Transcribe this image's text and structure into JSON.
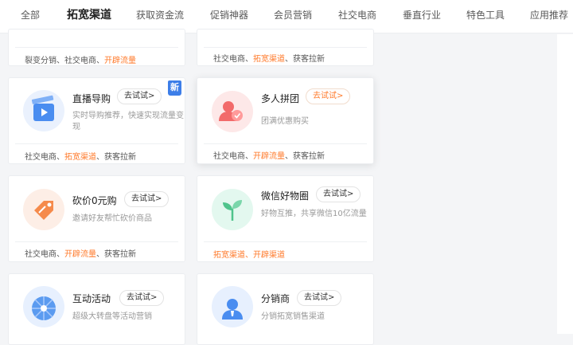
{
  "tabs": [
    "全部",
    "拓宽渠道",
    "获取资金流",
    "促销神器",
    "会员营销",
    "社交电商",
    "垂直行业",
    "特色工具",
    "应用推荐"
  ],
  "active_tab": "拓宽渠道",
  "accent_color": "#ff7a2b",
  "cards": [
    {
      "title": "",
      "try_label": "",
      "desc": "",
      "tags": [
        {
          "t": "裂变分销",
          "hl": false
        },
        {
          "t": "、",
          "hl": false
        },
        {
          "t": "社交电商",
          "hl": false
        },
        {
          "t": "、",
          "hl": false
        },
        {
          "t": "开辟流量",
          "hl": true
        }
      ]
    },
    {
      "title": "",
      "try_label": "",
      "desc": "",
      "tags": [
        {
          "t": "社交电商",
          "hl": false
        },
        {
          "t": "、",
          "hl": false
        },
        {
          "t": "拓宽渠道",
          "hl": true
        },
        {
          "t": "、",
          "hl": false
        },
        {
          "t": "获客拉新",
          "hl": false
        }
      ]
    },
    {
      "title": "直播导购",
      "try_label": "去试试>",
      "desc": "实时导购推荐，快速实现流量变现",
      "icon": "live-video-icon",
      "badge": "新",
      "tags": [
        {
          "t": "社交电商",
          "hl": false
        },
        {
          "t": "、",
          "hl": false
        },
        {
          "t": "拓宽渠道",
          "hl": true
        },
        {
          "t": "、",
          "hl": false
        },
        {
          "t": "获客拉新",
          "hl": false
        }
      ]
    },
    {
      "title": "多人拼团",
      "try_label": "去试试>",
      "desc": "团满优惠购买",
      "icon": "group-buy-icon",
      "tags": [
        {
          "t": "社交电商",
          "hl": false
        },
        {
          "t": "、",
          "hl": false
        },
        {
          "t": "开辟流量",
          "hl": true
        },
        {
          "t": "、",
          "hl": false
        },
        {
          "t": "获客拉新",
          "hl": false
        }
      ]
    },
    {
      "title": "砍价0元购",
      "try_label": "去试试>",
      "desc": "邀请好友帮忙砍价商品",
      "icon": "price-tag-icon",
      "tags": [
        {
          "t": "社交电商",
          "hl": false
        },
        {
          "t": "、",
          "hl": false
        },
        {
          "t": "开辟流量",
          "hl": true
        },
        {
          "t": "、",
          "hl": false
        },
        {
          "t": "获客拉新",
          "hl": false
        }
      ]
    },
    {
      "title": "微信好物圈",
      "try_label": "去试试>",
      "desc": "好物互推，共享微信10亿流量",
      "icon": "sprout-icon",
      "tags": [
        {
          "t": "拓宽渠道",
          "hl": true
        },
        {
          "t": "、",
          "hl": true
        },
        {
          "t": "开辟渠道",
          "hl": true
        }
      ]
    },
    {
      "title": "互动活动",
      "try_label": "去试试>",
      "desc": "超级大转盘等活动营销",
      "icon": "wheel-icon",
      "tags": []
    },
    {
      "title": "分销商",
      "try_label": "去试试>",
      "desc": "分销拓宽销售渠道",
      "icon": "distributor-icon",
      "tags": []
    }
  ]
}
